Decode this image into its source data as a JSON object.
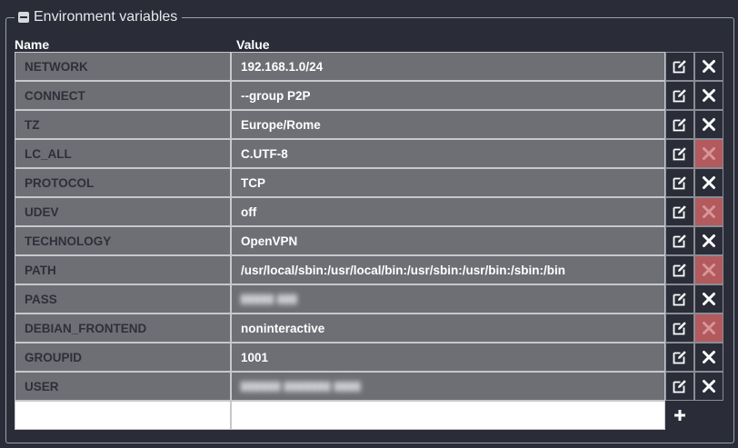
{
  "section": {
    "title": "Environment variables"
  },
  "columns": {
    "name": "Name",
    "value": "Value"
  },
  "rows": [
    {
      "name": "NETWORK",
      "value": "192.168.1.0/24",
      "removable": true,
      "masked": false
    },
    {
      "name": "CONNECT",
      "value": "--group P2P",
      "removable": true,
      "masked": false
    },
    {
      "name": "TZ",
      "value": "Europe/Rome",
      "removable": true,
      "masked": false
    },
    {
      "name": "LC_ALL",
      "value": "C.UTF-8",
      "removable": false,
      "masked": false
    },
    {
      "name": "PROTOCOL",
      "value": "TCP",
      "removable": true,
      "masked": false
    },
    {
      "name": "UDEV",
      "value": "off",
      "removable": false,
      "masked": false
    },
    {
      "name": "TECHNOLOGY",
      "value": "OpenVPN",
      "removable": true,
      "masked": false
    },
    {
      "name": "PATH",
      "value": "/usr/local/sbin:/usr/local/bin:/usr/sbin:/usr/bin:/sbin:/bin",
      "removable": false,
      "masked": false
    },
    {
      "name": "PASS",
      "value": "",
      "removable": true,
      "masked": true
    },
    {
      "name": "DEBIAN_FRONTEND",
      "value": "noninteractive",
      "removable": false,
      "masked": false
    },
    {
      "name": "GROUPID",
      "value": "1001",
      "removable": true,
      "masked": false
    },
    {
      "name": "USER",
      "value": "",
      "removable": true,
      "masked": true
    }
  ],
  "icons": {
    "collapse": "minus-square-icon",
    "edit": "edit-icon",
    "delete": "close-icon",
    "add": "plus-icon"
  },
  "colors": {
    "background": "#2a2d38",
    "cell": "#6e6f75",
    "disabled_delete": "#b25a5e"
  }
}
